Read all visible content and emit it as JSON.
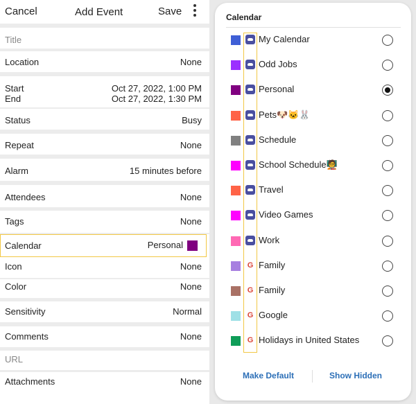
{
  "header": {
    "cancel": "Cancel",
    "title": "Add Event",
    "save": "Save"
  },
  "form": {
    "title_placeholder": "Title",
    "location": {
      "label": "Location",
      "value": "None"
    },
    "start": {
      "label": "Start",
      "value": "Oct 27, 2022, 1:00 PM"
    },
    "end": {
      "label": "End",
      "value": "Oct 27, 2022, 1:30 PM"
    },
    "status": {
      "label": "Status",
      "value": "Busy"
    },
    "repeat": {
      "label": "Repeat",
      "value": "None"
    },
    "alarm": {
      "label": "Alarm",
      "value": "15 minutes before"
    },
    "attendees": {
      "label": "Attendees",
      "value": "None"
    },
    "tags": {
      "label": "Tags",
      "value": "None"
    },
    "calendar": {
      "label": "Calendar",
      "value": "Personal",
      "color": "#800080"
    },
    "icon": {
      "label": "Icon",
      "value": "None"
    },
    "color": {
      "label": "Color",
      "value": "None"
    },
    "sensitivity": {
      "label": "Sensitivity",
      "value": "Normal"
    },
    "comments": {
      "label": "Comments",
      "value": "None"
    },
    "url_placeholder": "URL",
    "attachments": {
      "label": "Attachments",
      "value": "None"
    }
  },
  "dialog": {
    "title": "Calendar",
    "items": [
      {
        "name": "My Calendar",
        "color": "#3f5fd6",
        "icon": "cloud-icon",
        "selected": false
      },
      {
        "name": "Odd Jobs",
        "color": "#9b30ff",
        "icon": "cloud-icon",
        "selected": false
      },
      {
        "name": "Personal",
        "color": "#800080",
        "icon": "cloud-icon",
        "selected": true
      },
      {
        "name": "Pets🐶🐱🐰",
        "color": "#ff6347",
        "icon": "cloud-icon",
        "selected": false
      },
      {
        "name": "Schedule",
        "color": "#808080",
        "icon": "cloud-icon",
        "selected": false
      },
      {
        "name": "School Schedule🧑‍🏫",
        "color": "#ff00ff",
        "icon": "cloud-icon",
        "selected": false
      },
      {
        "name": "Travel",
        "color": "#ff6347",
        "icon": "cloud-icon",
        "selected": false
      },
      {
        "name": "Video Games",
        "color": "#ff00ff",
        "icon": "cloud-icon",
        "selected": false
      },
      {
        "name": "Work",
        "color": "#ff69b4",
        "icon": "cloud-icon",
        "selected": false
      },
      {
        "name": "Family",
        "color": "#a77fe0",
        "icon": "google-icon",
        "selected": false
      },
      {
        "name": "Family",
        "color": "#a97165",
        "icon": "google-icon",
        "selected": false
      },
      {
        "name": "Google",
        "color": "#9fe0e6",
        "icon": "google-icon",
        "selected": false
      },
      {
        "name": "Holidays in United States",
        "color": "#0f9d58",
        "icon": "google-icon",
        "selected": false
      }
    ],
    "make_default": "Make Default",
    "show_hidden": "Show Hidden"
  },
  "colors": {
    "highlight": "#f2c744",
    "link": "#2c6fb7"
  }
}
